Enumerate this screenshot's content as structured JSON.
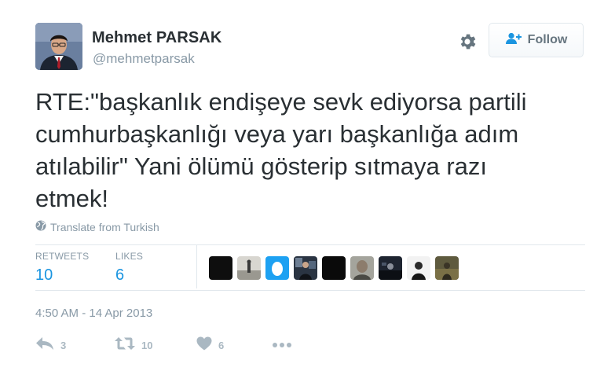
{
  "author": {
    "name": "Mehmet PARSAK",
    "handle": "@mehmetparsak"
  },
  "header": {
    "settings_icon": "gear-icon",
    "follow_label": "Follow",
    "follow_icon": "add-user-icon"
  },
  "tweet": {
    "text": "RTE:\"başkanlık endişeye sevk ediyorsa partili\ncumhurbaşkanlığı veya yarı başkanlığa adım\natılabilir\" Yani ölümü gösterip sıtmaya razı\netmek!",
    "translate_label": "Translate from Turkish",
    "translate_icon": "globe-icon"
  },
  "stats": {
    "retweets_label": "RETWEETS",
    "retweets_value": "10",
    "likes_label": "LIKES",
    "likes_value": "6"
  },
  "timestamp": "4:50 AM - 14 Apr 2013",
  "actions": {
    "reply_count": "3",
    "retweet_count": "10",
    "like_count": "6",
    "more_icon": "more-icon"
  },
  "colors": {
    "link_blue": "#1b95e0",
    "muted": "#8899a6",
    "action_grey": "#aab8c2",
    "divider": "#e1e8ed"
  }
}
